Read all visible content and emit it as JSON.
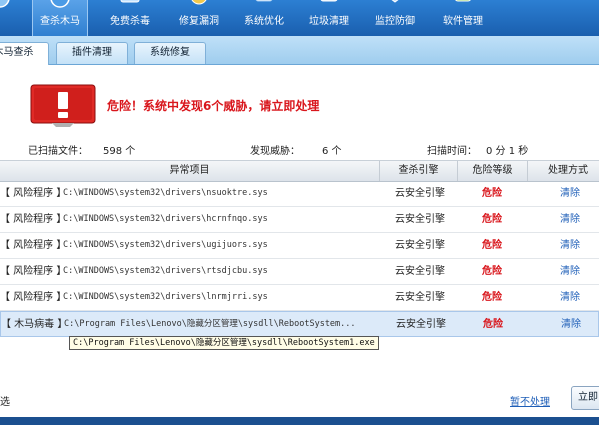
{
  "toolbar": {
    "items": [
      {
        "label": "查杀木马",
        "icon": "shield-scan-icon",
        "active": true
      },
      {
        "label": "免费杀毒",
        "icon": "antivirus-icon"
      },
      {
        "label": "修复漏洞",
        "icon": "patch-icon"
      },
      {
        "label": "系统优化",
        "icon": "optimize-icon"
      },
      {
        "label": "垃圾清理",
        "icon": "trash-clean-icon"
      },
      {
        "label": "监控防御",
        "icon": "monitor-icon"
      },
      {
        "label": "软件管理",
        "icon": "software-icon"
      }
    ]
  },
  "tabs": [
    {
      "label": "木马查杀",
      "active": true
    },
    {
      "label": "插件清理"
    },
    {
      "label": "系统修复"
    }
  ],
  "alert": {
    "message": "危险！系统中发现6个威胁，请立即处理",
    "icon": "danger-exclamation-icon",
    "color": "#d9161c"
  },
  "stats": {
    "scanned_label": "已扫描文件：",
    "scanned_value": "598 个",
    "threats_label": "发现威胁：",
    "threats_value": "6 个",
    "time_label": "扫描时间：",
    "time_value": "0 分 1 秒"
  },
  "table": {
    "columns": [
      "异常项目",
      "查杀引擎",
      "危险等级",
      "处理方式"
    ],
    "rows": [
      {
        "type": "【 风险程序 】",
        "path": "C:\\WINDOWS\\system32\\drivers\\nsuoktre.sys",
        "engine": "云安全引擎",
        "level": "危险",
        "action": "清除"
      },
      {
        "type": "【 风险程序 】",
        "path": "C:\\WINDOWS\\system32\\drivers\\hcrnfnqo.sys",
        "engine": "云安全引擎",
        "level": "危险",
        "action": "清除"
      },
      {
        "type": "【 风险程序 】",
        "path": "C:\\WINDOWS\\system32\\drivers\\ugijuors.sys",
        "engine": "云安全引擎",
        "level": "危险",
        "action": "清除"
      },
      {
        "type": "【 风险程序 】",
        "path": "C:\\WINDOWS\\system32\\drivers\\rtsdjcbu.sys",
        "engine": "云安全引擎",
        "level": "危险",
        "action": "清除"
      },
      {
        "type": "【 风险程序 】",
        "path": "C:\\WINDOWS\\system32\\drivers\\lnrmjrri.sys",
        "engine": "云安全引擎",
        "level": "危险",
        "action": "清除"
      },
      {
        "type": "【 木马病毒 】",
        "path": "C:\\Program Files\\Lenovo\\隐藏分区管理\\sysdll\\RebootSystem...",
        "engine": "云安全引擎",
        "level": "危险",
        "action": "清除",
        "selected": true
      }
    ]
  },
  "tooltip": "C:\\Program Files\\Lenovo\\隐藏分区管理\\sysdll\\RebootSystem1.exe",
  "footer": {
    "select_label": "选",
    "ignore_link": "暂不处理",
    "action_button": "立即"
  },
  "colors": {
    "toolbar": "#1a5fae",
    "danger": "#d9161c",
    "link": "#1f5fb8"
  }
}
